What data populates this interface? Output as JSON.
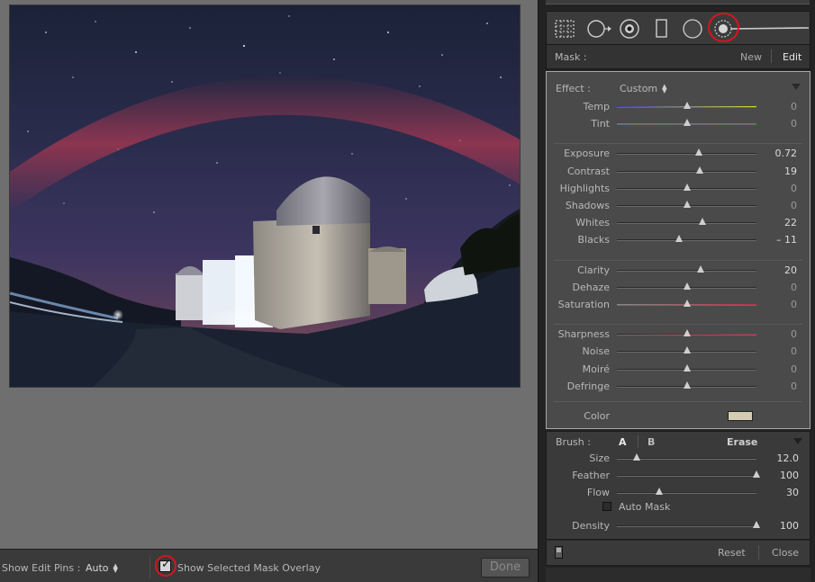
{
  "canvas": {
    "photo_subject": ""
  },
  "toolbar": {
    "show_edit_pins_label": "Show Edit Pins :",
    "show_edit_pins_value": "Auto",
    "overlay_checkbox_checked": true,
    "overlay_label": "Show Selected Mask Overlay",
    "done_label": "Done"
  },
  "tools": [
    {
      "name": "crop-overlay-icon"
    },
    {
      "name": "spot-removal-icon"
    },
    {
      "name": "red-eye-icon"
    },
    {
      "name": "graduated-filter-icon"
    },
    {
      "name": "radial-filter-icon"
    },
    {
      "name": "adjustment-brush-icon",
      "active": true
    }
  ],
  "mask": {
    "label": "Mask :",
    "new_label": "New",
    "edit_label": "Edit"
  },
  "effect": {
    "label": "Effect :",
    "preset": "Custom",
    "groups": [
      [
        {
          "label": "Temp",
          "value": "0",
          "pos": 0.5
        },
        {
          "label": "Tint",
          "value": "0",
          "pos": 0.5
        }
      ],
      [
        {
          "label": "Exposure",
          "value": "0.72",
          "pos": 0.59
        },
        {
          "label": "Contrast",
          "value": "19",
          "pos": 0.595
        },
        {
          "label": "Highlights",
          "value": "0",
          "pos": 0.5
        },
        {
          "label": "Shadows",
          "value": "0",
          "pos": 0.5
        },
        {
          "label": "Whites",
          "value": "22",
          "pos": 0.61
        },
        {
          "label": "Blacks",
          "value": "– 11",
          "pos": 0.445
        }
      ],
      [
        {
          "label": "Clarity",
          "value": "20",
          "pos": 0.6
        },
        {
          "label": "Dehaze",
          "value": "0",
          "pos": 0.5
        },
        {
          "label": "Saturation",
          "value": "0",
          "pos": 0.5
        }
      ],
      [
        {
          "label": "Sharpness",
          "value": "0",
          "pos": 0.5
        },
        {
          "label": "Noise",
          "value": "0",
          "pos": 0.5
        },
        {
          "label": "Moiré",
          "value": "0",
          "pos": 0.5
        },
        {
          "label": "Defringe",
          "value": "0",
          "pos": 0.5
        }
      ]
    ],
    "color_label": "Color",
    "color_swatch": "#d3ccb2"
  },
  "brush": {
    "label": "Brush :",
    "a_label": "A",
    "b_label": "B",
    "erase_label": "Erase",
    "sliders": [
      {
        "label": "Size",
        "value": "12.0",
        "pos": 0.14
      },
      {
        "label": "Feather",
        "value": "100",
        "pos": 1.0
      },
      {
        "label": "Flow",
        "value": "30",
        "pos": 0.3
      }
    ],
    "auto_mask_label": "Auto Mask",
    "auto_mask_checked": false,
    "density": {
      "label": "Density",
      "value": "100",
      "pos": 1.0
    }
  },
  "footer": {
    "reset_label": "Reset",
    "close_label": "Close"
  },
  "colors": {
    "temp_track": [
      "#2d3fb0",
      "#d8cf3a"
    ],
    "tint_track": [
      "#2fa03a",
      "#b13fc0"
    ],
    "saturation_track": [
      "#888888",
      "#c03040"
    ],
    "sharpness_tint": "#b03040",
    "highlight_ring": "#d8151b"
  }
}
